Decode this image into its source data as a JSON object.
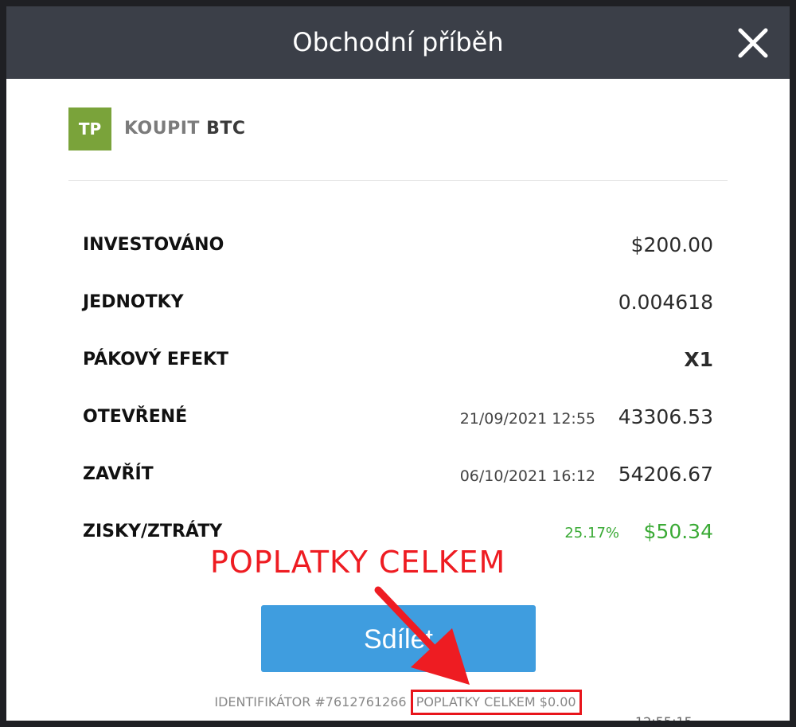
{
  "header": {
    "title": "Obchodní příběh"
  },
  "instrument": {
    "avatar": "TP",
    "action": "KOUPIT",
    "symbol": "BTC",
    "avatar_color": "#7aa33a"
  },
  "rows": {
    "invested": {
      "label": "INVESTOVÁNO",
      "value": "$200.00"
    },
    "units": {
      "label": "JEDNOTKY",
      "value": "0.004618"
    },
    "leverage": {
      "label": "PÁKOVÝ EFEKT",
      "value": "X1"
    },
    "open": {
      "label": "OTEVŘENÉ",
      "date": "21/09/2021 12:55",
      "value": "43306.53"
    },
    "close": {
      "label": "ZAVŘÍT",
      "date": "06/10/2021 16:12",
      "value": "54206.67"
    },
    "pnl": {
      "label": "ZISKY/ZTRÁTY",
      "percent": "25.17%",
      "value": "$50.34",
      "color": "#3aaa35"
    }
  },
  "share_button": {
    "label": "Sdílet"
  },
  "footer": {
    "id_text": "IDENTIFIKÁTOR #7612761266",
    "fees_text": "POPLATKY CELKEM $0.00"
  },
  "annotation": {
    "text": "POPLATKY CELKEM",
    "color": "#ee1c22"
  },
  "colors": {
    "header_bg": "#3b3f48",
    "button_bg": "#3f9ddf",
    "profit": "#3aaa35",
    "highlight": "#e8151b"
  },
  "icons": {
    "close": "close-icon",
    "arrow": "arrow-icon"
  }
}
